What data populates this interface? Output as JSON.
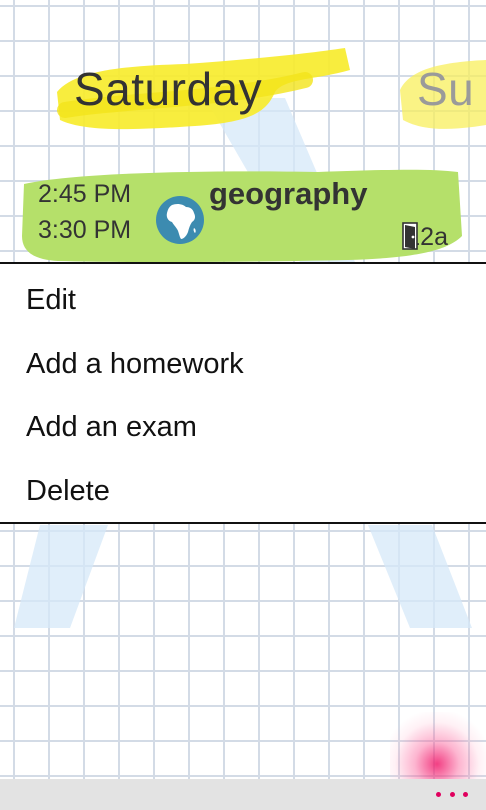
{
  "schedule": {
    "current_day": "Saturday",
    "next_day_partial": "Su",
    "lesson": {
      "start_time": "2:45 PM",
      "end_time": "3:30 PM",
      "subject": "geography",
      "room": "12a",
      "icon": "globe-africa-icon",
      "highlight_color": "#b5e06a"
    },
    "day_highlight_color": "#f7ec2e"
  },
  "context_menu": {
    "items": [
      {
        "label": "Edit"
      },
      {
        "label": "Add a homework"
      },
      {
        "label": "Add an exam"
      },
      {
        "label": "Delete"
      }
    ]
  },
  "appbar": {
    "more_icon": "ellipsis-icon",
    "accent_color": "#e0005e"
  }
}
